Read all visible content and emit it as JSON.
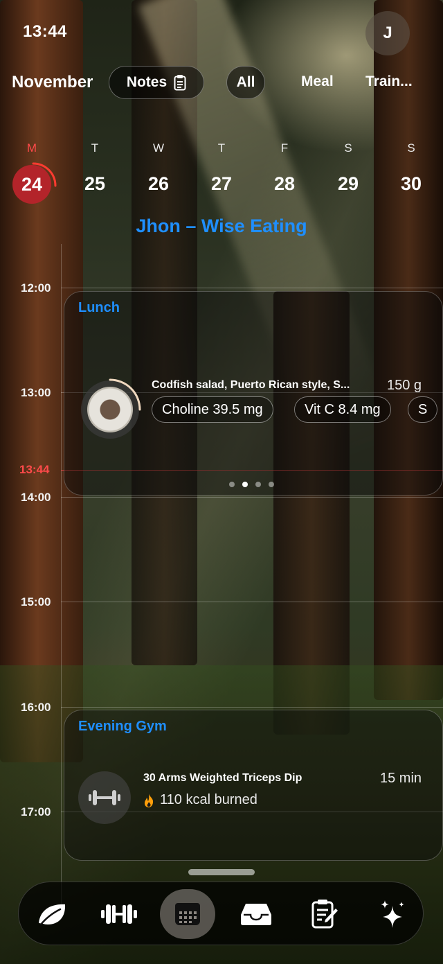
{
  "status": {
    "time": "13:44"
  },
  "profile": {
    "initial": "J"
  },
  "header": {
    "month": "November",
    "notes_label": "Notes",
    "filters": [
      "All",
      "Meal",
      "Train..."
    ]
  },
  "week": {
    "days": [
      {
        "letter": "M",
        "num": "24",
        "today": true
      },
      {
        "letter": "T",
        "num": "25"
      },
      {
        "letter": "W",
        "num": "26"
      },
      {
        "letter": "T",
        "num": "27"
      },
      {
        "letter": "F",
        "num": "28"
      },
      {
        "letter": "S",
        "num": "29"
      },
      {
        "letter": "S",
        "num": "30"
      }
    ]
  },
  "plan_title": "Jhon – Wise Eating",
  "timeline": {
    "hours": [
      "12:00",
      "13:00",
      "13:44",
      "14:00",
      "15:00",
      "16:00",
      "17:00"
    ],
    "now_label": "13:44"
  },
  "lunch": {
    "title": "Lunch",
    "food_name": "Codfish salad, Puerto Rican style, S...",
    "weight": "150 g",
    "nutrients": [
      "Choline 39.5 mg",
      "Vit C 8.4 mg",
      "S"
    ],
    "page_count": 4,
    "active_page": 2
  },
  "gym": {
    "title": "Evening Gym",
    "exercise": "30 Arms Weighted Triceps Dip",
    "duration": "15 min",
    "kcal": "110 kcal burned"
  },
  "tabbar": {
    "items": [
      "leaf-icon",
      "dumbbell-icon",
      "calendar-icon",
      "inbox-icon",
      "notes-edit-icon",
      "sparkles-icon"
    ],
    "active": "calendar-icon"
  },
  "colors": {
    "accent": "#1f8fff",
    "today": "#b3242a",
    "now": "#ff4a4a"
  }
}
